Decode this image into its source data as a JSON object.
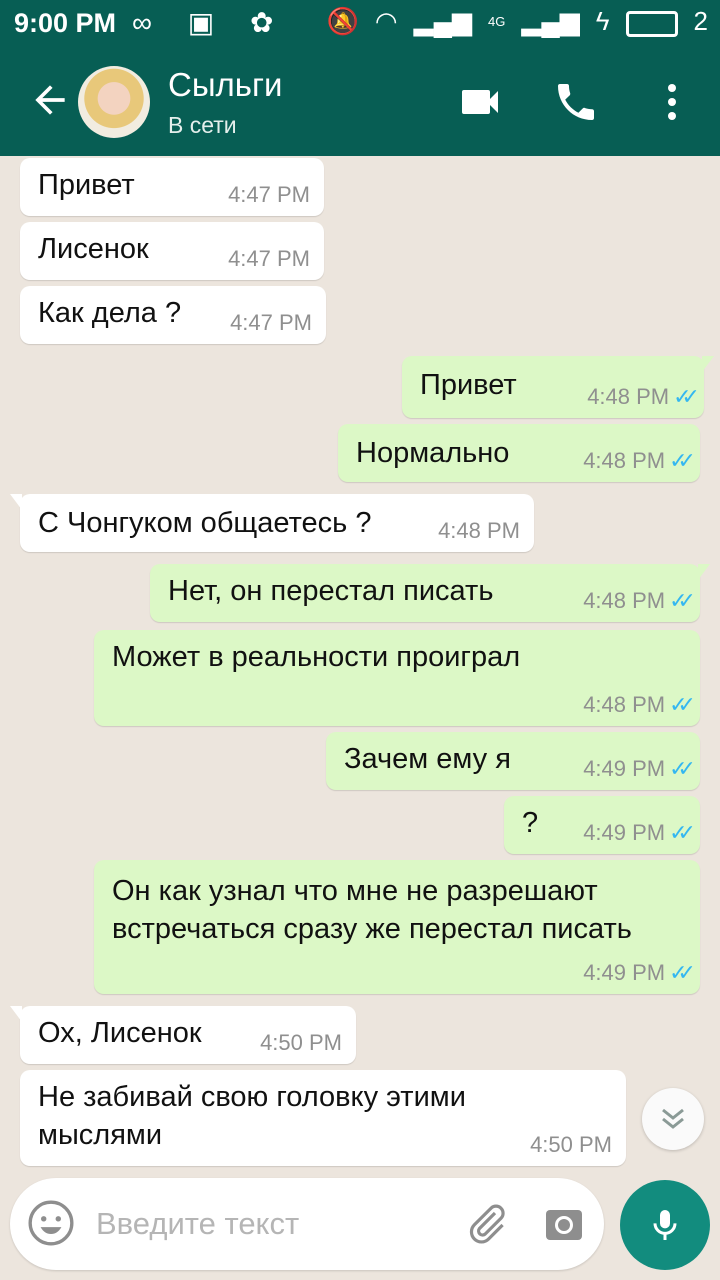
{
  "status_bar": {
    "time": "9:00 PM",
    "sim_label": "4G",
    "battery_level": "2"
  },
  "header": {
    "contact_name": "Сыльги",
    "contact_status": "В сети"
  },
  "messages": [
    {
      "text": "Привет",
      "time": "4:47 PM"
    },
    {
      "text": "Лисенок",
      "time": "4:47 PM"
    },
    {
      "text": "Как дела ?",
      "time": "4:47 PM"
    },
    {
      "text": "Привет",
      "time": "4:48 PM"
    },
    {
      "text": "Нормально",
      "time": "4:48 PM"
    },
    {
      "text": "С Чонгуком общаетесь ?",
      "time": "4:48 PM"
    },
    {
      "text": "Нет, он перестал писать",
      "time": "4:48 PM"
    },
    {
      "text": "Может в реальности проиграл",
      "time": "4:48 PM"
    },
    {
      "text": "Зачем ему я",
      "time": "4:49 PM"
    },
    {
      "text": "?",
      "time": "4:49 PM"
    },
    {
      "text": "Он как узнал что мне не разрешают встречаться сразу же перестал писать",
      "time": "4:49 PM"
    },
    {
      "text": "Ох, Лисенок",
      "time": "4:50 PM"
    },
    {
      "text": "Не забивай  свою головку этими мыслями",
      "time": "4:50 PM"
    }
  ],
  "composer": {
    "placeholder": "Введите текст"
  },
  "colors": {
    "header": "#075e54",
    "outgoing_bubble": "#dcf8c6",
    "incoming_bubble": "#ffffff",
    "read_ticks": "#34b7f1",
    "mic_button": "#128c7e"
  },
  "icons": [
    "back-arrow-icon",
    "video-call-icon",
    "phone-icon",
    "more-vert-icon",
    "scroll-down-icon",
    "emoji-icon",
    "attach-icon",
    "camera-icon",
    "mic-icon"
  ]
}
